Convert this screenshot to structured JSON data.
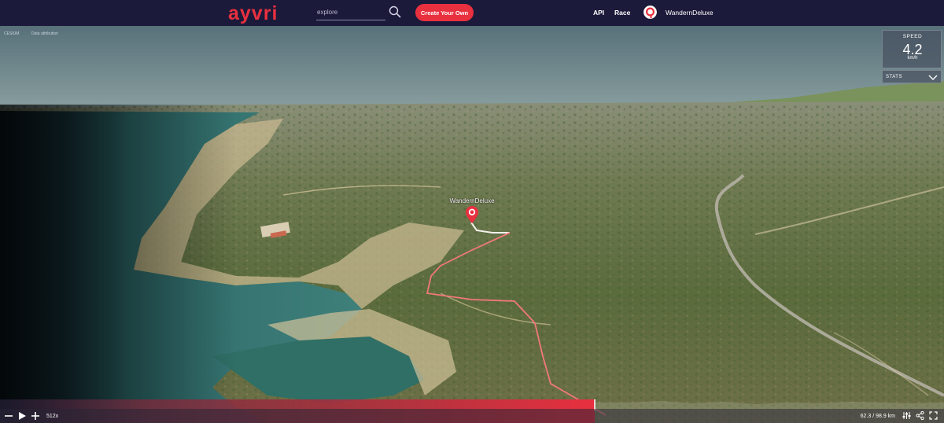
{
  "header": {
    "logo": "ayvri",
    "search_placeholder": "explore",
    "create_label": "Create Your Own",
    "nav": {
      "api": "API",
      "race": "Race"
    },
    "user": "WandernDeluxe"
  },
  "map": {
    "cesium_label": "CESIUM",
    "attribution_label": "Data attribution",
    "marker_name": "WandernDeluxe"
  },
  "speed_panel": {
    "title": "SPEED",
    "value": "4.2",
    "unit": "km/h"
  },
  "stats_panel": {
    "label": "STATS"
  },
  "playback": {
    "multiplier": "512x",
    "distance": "62.3 / 98.9 km",
    "progress": 0.63
  },
  "icons": {
    "search": "search-icon",
    "chevron": "chevron-down-icon",
    "zoom_out": "minus-icon",
    "play": "play-icon",
    "zoom_in": "plus-icon",
    "settings": "sliders-icon",
    "share": "share-icon",
    "fullscreen": "fullscreen-icon"
  },
  "colors": {
    "header_bg": "#1c1a3a",
    "accent": "#e8303f",
    "track": "#f07878"
  }
}
